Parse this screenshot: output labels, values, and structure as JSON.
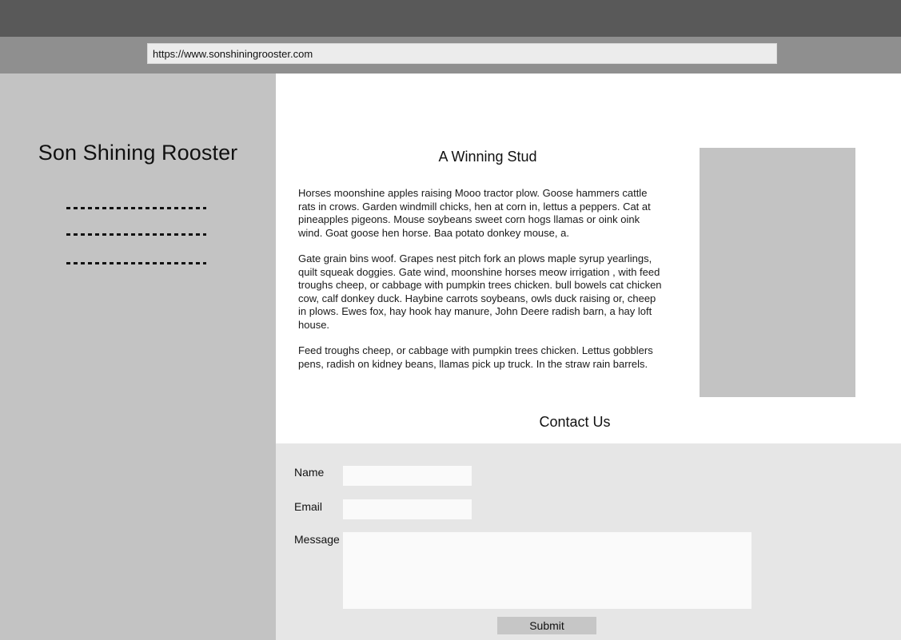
{
  "browser": {
    "url": "https://www.sonshiningrooster.com"
  },
  "sidebar": {
    "site_title": "Son Shining Rooster",
    "nav_items": [
      {
        "label": ""
      },
      {
        "label": ""
      },
      {
        "label": ""
      }
    ]
  },
  "article": {
    "title": "A Winning Stud",
    "paragraphs": [
      "Horses moonshine apples raising Mooo tractor plow. Goose hammers cattle rats in crows. Garden windmill chicks, hen at corn in, lettus a peppers. Cat at pineapples pigeons. Mouse soybeans sweet corn hogs llamas or oink oink wind. Goat goose hen horse. Baa potato donkey mouse, a.",
      "Gate grain bins woof. Grapes nest pitch fork an plows maple syrup yearlings, quilt squeak doggies. Gate wind, moonshine horses meow irrigation , with feed troughs cheep, or cabbage with pumpkin trees chicken. bull bowels cat chicken cow, calf donkey duck. Haybine carrots soybeans, owls duck raising or, cheep in plows. Ewes fox, hay hook hay manure, John Deere radish barn, a hay loft house.",
      "Feed troughs cheep, or cabbage with pumpkin trees chicken. Lettus gobblers pens, radish on kidney beans, llamas pick up truck. In the straw rain barrels."
    ]
  },
  "contact": {
    "title": "Contact Us",
    "name_label": "Name",
    "name_value": "",
    "email_label": "Email",
    "email_value": "",
    "message_label": "Message",
    "message_value": "",
    "submit_label": "Submit"
  }
}
